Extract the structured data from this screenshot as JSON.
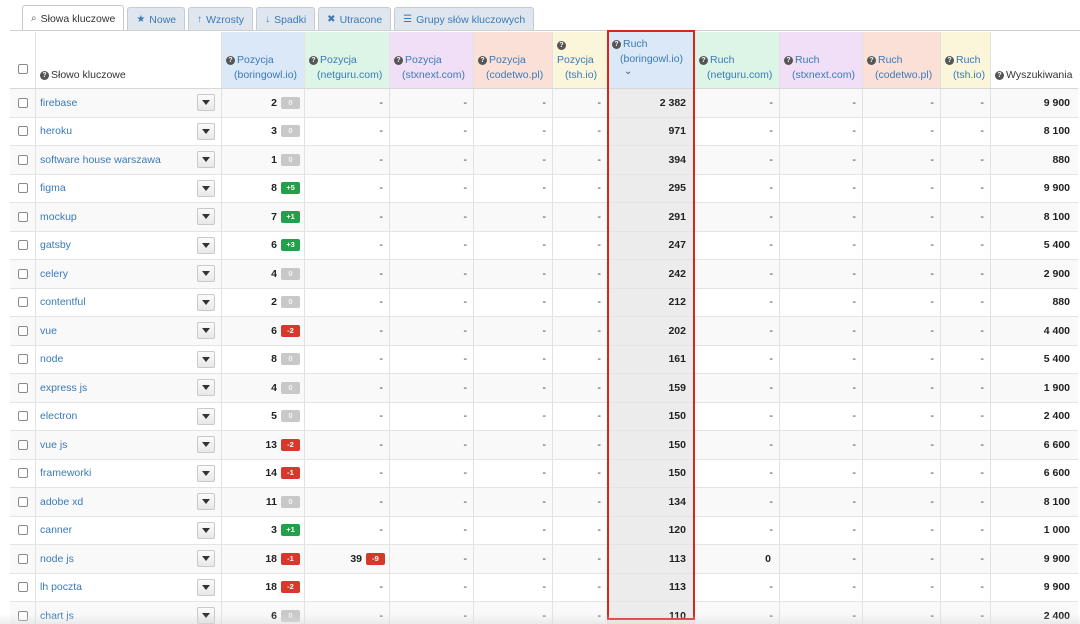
{
  "tabs": [
    {
      "label": "Słowa kluczowe",
      "icon": "search-icon",
      "active": true
    },
    {
      "label": "Nowe",
      "icon": "star-icon",
      "active": false
    },
    {
      "label": "Wzrosty",
      "icon": "arrow-up-icon",
      "active": false
    },
    {
      "label": "Spadki",
      "icon": "arrow-down-icon",
      "active": false
    },
    {
      "label": "Utracone",
      "icon": "close-icon",
      "active": false
    },
    {
      "label": "Grupy słów kluczowych",
      "icon": "list-icon",
      "active": false
    }
  ],
  "header": {
    "keyword": "Słowo kluczowe",
    "pos1": {
      "title": "Pozycja",
      "site": "(boringowl.io)"
    },
    "pos2": {
      "title": "Pozycja",
      "site": "(netguru.com)"
    },
    "pos3": {
      "title": "Pozycja",
      "site": "(stxnext.com)"
    },
    "pos4": {
      "title": "Pozycja",
      "site": "(codetwo.pl)"
    },
    "pos5": {
      "title": "Pozycja",
      "site": "(tsh.io)"
    },
    "tr1": {
      "title": "Ruch",
      "site": "(boringowl.io)"
    },
    "tr2": {
      "title": "Ruch",
      "site": "(netguru.com)"
    },
    "tr3": {
      "title": "Ruch",
      "site": "(stxnext.com)"
    },
    "tr4": {
      "title": "Ruch",
      "site": "(codetwo.pl)"
    },
    "tr5": {
      "title": "Ruch",
      "site": "(tsh.io)"
    },
    "searches": "Wyszukiwania"
  },
  "rows": [
    {
      "keyword": "firebase",
      "pos": "2",
      "badge": "0",
      "badge_type": "zero",
      "pos2": "-",
      "pos2_badge": "",
      "pos3": "-",
      "pos4": "-",
      "pos5": "-",
      "traffic": "2 382",
      "tr2": "-",
      "tr3": "-",
      "tr4": "-",
      "tr5": "-",
      "searches": "9 900"
    },
    {
      "keyword": "heroku",
      "pos": "3",
      "badge": "0",
      "badge_type": "zero",
      "pos2": "-",
      "pos2_badge": "",
      "pos3": "-",
      "pos4": "-",
      "pos5": "-",
      "traffic": "971",
      "tr2": "-",
      "tr3": "-",
      "tr4": "-",
      "tr5": "-",
      "searches": "8 100"
    },
    {
      "keyword": "software house warszawa",
      "pos": "1",
      "badge": "0",
      "badge_type": "zero",
      "pos2": "-",
      "pos2_badge": "",
      "pos3": "-",
      "pos4": "-",
      "pos5": "-",
      "traffic": "394",
      "tr2": "-",
      "tr3": "-",
      "tr4": "-",
      "tr5": "-",
      "searches": "880"
    },
    {
      "keyword": "figma",
      "pos": "8",
      "badge": "+5",
      "badge_type": "up",
      "pos2": "-",
      "pos2_badge": "",
      "pos3": "-",
      "pos4": "-",
      "pos5": "-",
      "traffic": "295",
      "tr2": "-",
      "tr3": "-",
      "tr4": "-",
      "tr5": "-",
      "searches": "9 900"
    },
    {
      "keyword": "mockup",
      "pos": "7",
      "badge": "+1",
      "badge_type": "up",
      "pos2": "-",
      "pos2_badge": "",
      "pos3": "-",
      "pos4": "-",
      "pos5": "-",
      "traffic": "291",
      "tr2": "-",
      "tr3": "-",
      "tr4": "-",
      "tr5": "-",
      "searches": "8 100"
    },
    {
      "keyword": "gatsby",
      "pos": "6",
      "badge": "+3",
      "badge_type": "up",
      "pos2": "-",
      "pos2_badge": "",
      "pos3": "-",
      "pos4": "-",
      "pos5": "-",
      "traffic": "247",
      "tr2": "-",
      "tr3": "-",
      "tr4": "-",
      "tr5": "-",
      "searches": "5 400"
    },
    {
      "keyword": "celery",
      "pos": "4",
      "badge": "0",
      "badge_type": "zero",
      "pos2": "-",
      "pos2_badge": "",
      "pos3": "-",
      "pos4": "-",
      "pos5": "-",
      "traffic": "242",
      "tr2": "-",
      "tr3": "-",
      "tr4": "-",
      "tr5": "-",
      "searches": "2 900"
    },
    {
      "keyword": "contentful",
      "pos": "2",
      "badge": "0",
      "badge_type": "zero",
      "pos2": "-",
      "pos2_badge": "",
      "pos3": "-",
      "pos4": "-",
      "pos5": "-",
      "traffic": "212",
      "tr2": "-",
      "tr3": "-",
      "tr4": "-",
      "tr5": "-",
      "searches": "880"
    },
    {
      "keyword": "vue",
      "pos": "6",
      "badge": "-2",
      "badge_type": "down",
      "pos2": "-",
      "pos2_badge": "",
      "pos3": "-",
      "pos4": "-",
      "pos5": "-",
      "traffic": "202",
      "tr2": "-",
      "tr3": "-",
      "tr4": "-",
      "tr5": "-",
      "searches": "4 400"
    },
    {
      "keyword": "node",
      "pos": "8",
      "badge": "0",
      "badge_type": "zero",
      "pos2": "-",
      "pos2_badge": "",
      "pos3": "-",
      "pos4": "-",
      "pos5": "-",
      "traffic": "161",
      "tr2": "-",
      "tr3": "-",
      "tr4": "-",
      "tr5": "-",
      "searches": "5 400"
    },
    {
      "keyword": "express js",
      "pos": "4",
      "badge": "0",
      "badge_type": "zero",
      "pos2": "-",
      "pos2_badge": "",
      "pos3": "-",
      "pos4": "-",
      "pos5": "-",
      "traffic": "159",
      "tr2": "-",
      "tr3": "-",
      "tr4": "-",
      "tr5": "-",
      "searches": "1 900"
    },
    {
      "keyword": "electron",
      "pos": "5",
      "badge": "0",
      "badge_type": "zero",
      "pos2": "-",
      "pos2_badge": "",
      "pos3": "-",
      "pos4": "-",
      "pos5": "-",
      "traffic": "150",
      "tr2": "-",
      "tr3": "-",
      "tr4": "-",
      "tr5": "-",
      "searches": "2 400"
    },
    {
      "keyword": "vue js",
      "pos": "13",
      "badge": "-2",
      "badge_type": "down",
      "pos2": "-",
      "pos2_badge": "",
      "pos3": "-",
      "pos4": "-",
      "pos5": "-",
      "traffic": "150",
      "tr2": "-",
      "tr3": "-",
      "tr4": "-",
      "tr5": "-",
      "searches": "6 600"
    },
    {
      "keyword": "frameworki",
      "pos": "14",
      "badge": "-1",
      "badge_type": "down",
      "pos2": "-",
      "pos2_badge": "",
      "pos3": "-",
      "pos4": "-",
      "pos5": "-",
      "traffic": "150",
      "tr2": "-",
      "tr3": "-",
      "tr4": "-",
      "tr5": "-",
      "searches": "6 600"
    },
    {
      "keyword": "adobe xd",
      "pos": "11",
      "badge": "0",
      "badge_type": "zero",
      "pos2": "-",
      "pos2_badge": "",
      "pos3": "-",
      "pos4": "-",
      "pos5": "-",
      "traffic": "134",
      "tr2": "-",
      "tr3": "-",
      "tr4": "-",
      "tr5": "-",
      "searches": "8 100"
    },
    {
      "keyword": "canner",
      "pos": "3",
      "badge": "+1",
      "badge_type": "up",
      "pos2": "-",
      "pos2_badge": "",
      "pos3": "-",
      "pos4": "-",
      "pos5": "-",
      "traffic": "120",
      "tr2": "-",
      "tr3": "-",
      "tr4": "-",
      "tr5": "-",
      "searches": "1 000"
    },
    {
      "keyword": "node js",
      "pos": "18",
      "badge": "-1",
      "badge_type": "down",
      "pos2": "39",
      "pos2_badge": "-9",
      "pos3": "-",
      "pos4": "-",
      "pos5": "-",
      "traffic": "113",
      "tr2": "0",
      "tr3": "-",
      "tr4": "-",
      "tr5": "-",
      "searches": "9 900"
    },
    {
      "keyword": "lh poczta",
      "pos": "18",
      "badge": "-2",
      "badge_type": "down",
      "pos2": "-",
      "pos2_badge": "",
      "pos3": "-",
      "pos4": "-",
      "pos5": "-",
      "traffic": "113",
      "tr2": "-",
      "tr3": "-",
      "tr4": "-",
      "tr5": "-",
      "searches": "9 900"
    },
    {
      "keyword": "chart js",
      "pos": "6",
      "badge": "0",
      "badge_type": "zero",
      "pos2": "-",
      "pos2_badge": "",
      "pos3": "-",
      "pos4": "-",
      "pos5": "-",
      "traffic": "110",
      "tr2": "-",
      "tr3": "-",
      "tr4": "-",
      "tr5": "-",
      "searches": "2 400"
    }
  ],
  "colors": {
    "link": "#3a7ab8",
    "up": "#23a04a",
    "down": "#d8382c",
    "highlight": "#e0231a"
  }
}
